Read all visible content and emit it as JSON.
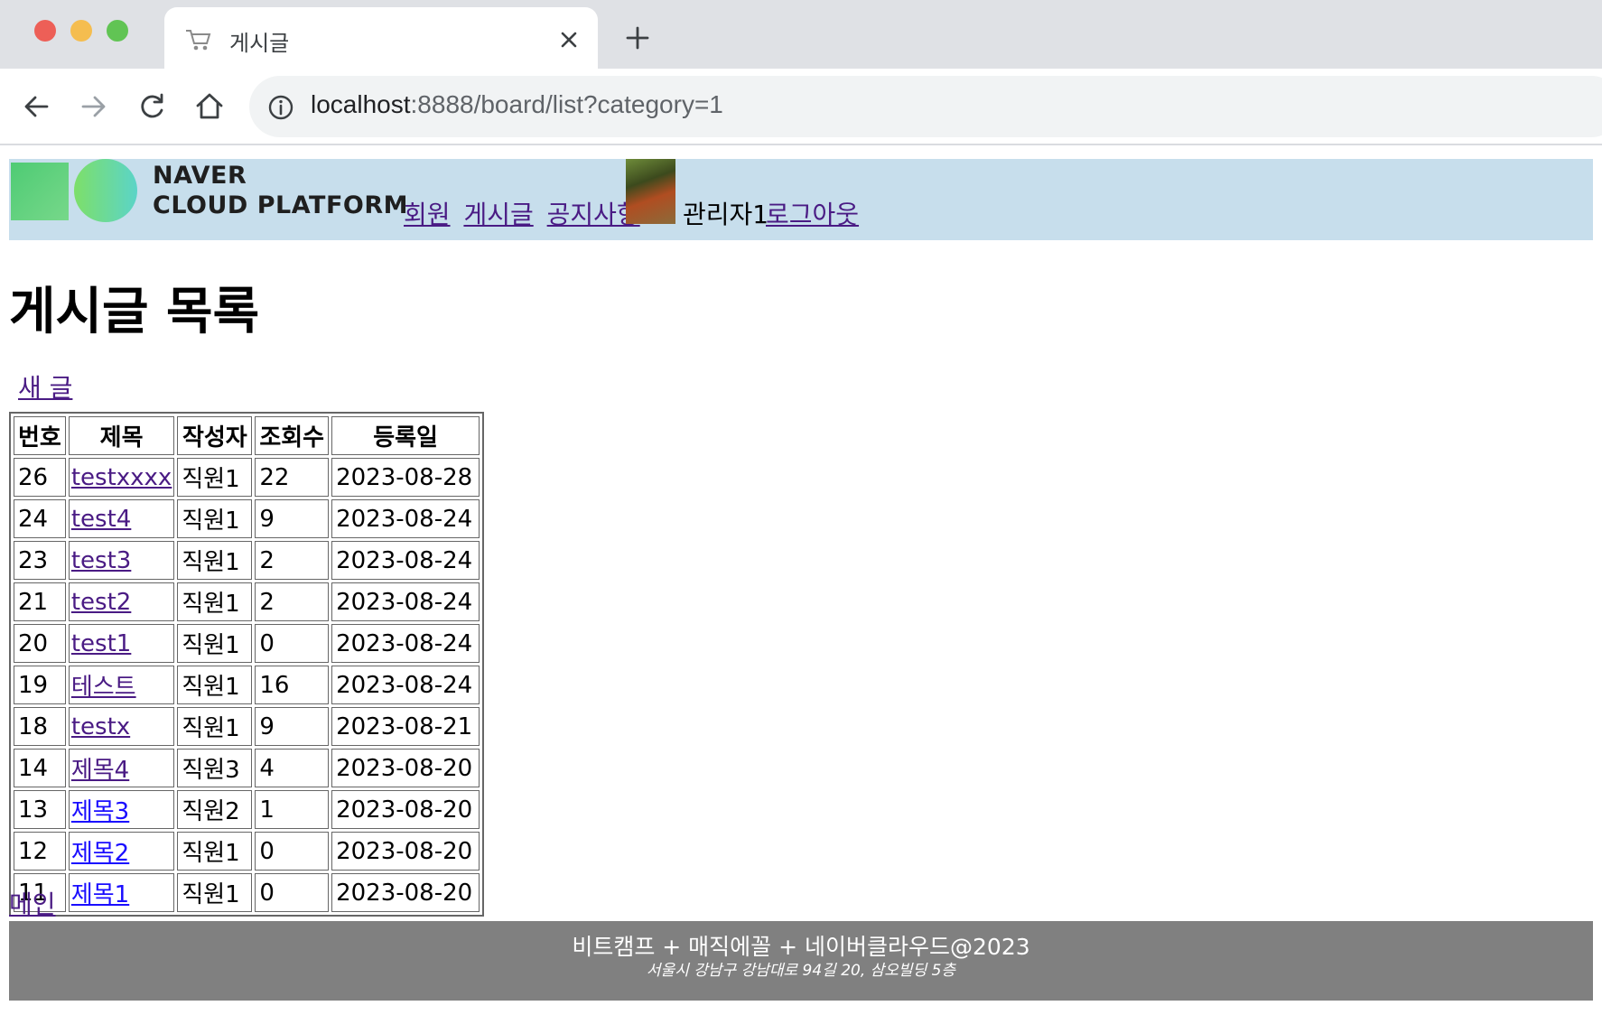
{
  "browser": {
    "tab_title": "게시글",
    "url_host": "localhost",
    "url_rest": ":8888/board/list?category=1"
  },
  "header": {
    "logo_line1": "NAVER",
    "logo_line2": "CLOUD PLATFORM",
    "nav": [
      "회원",
      "게시글",
      "공지사항"
    ],
    "user_name": "관리자1",
    "logout_label": "로그아웃"
  },
  "main": {
    "title": "게시글 목록",
    "new_post_label": "새 글",
    "columns": [
      "번호",
      "제목",
      "작성자",
      "조회수",
      "등록일"
    ],
    "rows": [
      {
        "no": "26",
        "title": "testxxxx",
        "writer": "직원1",
        "views": "22",
        "date": "2023-08-28",
        "visited": true
      },
      {
        "no": "24",
        "title": "test4",
        "writer": "직원1",
        "views": "9",
        "date": "2023-08-24",
        "visited": true
      },
      {
        "no": "23",
        "title": "test3",
        "writer": "직원1",
        "views": "2",
        "date": "2023-08-24",
        "visited": true
      },
      {
        "no": "21",
        "title": "test2",
        "writer": "직원1",
        "views": "2",
        "date": "2023-08-24",
        "visited": true
      },
      {
        "no": "20",
        "title": "test1",
        "writer": "직원1",
        "views": "0",
        "date": "2023-08-24",
        "visited": true
      },
      {
        "no": "19",
        "title": "테스트",
        "writer": "직원1",
        "views": "16",
        "date": "2023-08-24",
        "visited": true
      },
      {
        "no": "18",
        "title": "testx",
        "writer": "직원1",
        "views": "9",
        "date": "2023-08-21",
        "visited": true
      },
      {
        "no": "14",
        "title": "제목4",
        "writer": "직원3",
        "views": "4",
        "date": "2023-08-20",
        "visited": true
      },
      {
        "no": "13",
        "title": "제목3",
        "writer": "직원2",
        "views": "1",
        "date": "2023-08-20",
        "visited": false
      },
      {
        "no": "12",
        "title": "제목2",
        "writer": "직원1",
        "views": "0",
        "date": "2023-08-20",
        "visited": false
      },
      {
        "no": "11",
        "title": "제목1",
        "writer": "직원1",
        "views": "0",
        "date": "2023-08-20",
        "visited": false
      }
    ],
    "main_link_label": "메인"
  },
  "footer": {
    "line1": "비트캠프 + 매직에꼴 + 네이버클라우드@2023",
    "line2": "서울시 강남구 강남대로 94길 20, 삼오빌딩 5층"
  },
  "colors": {
    "header_bg": "#c7deec",
    "footer_bg": "#808080",
    "visited_link": "#4a1b84",
    "unvisited_link": "#1a0dff"
  }
}
